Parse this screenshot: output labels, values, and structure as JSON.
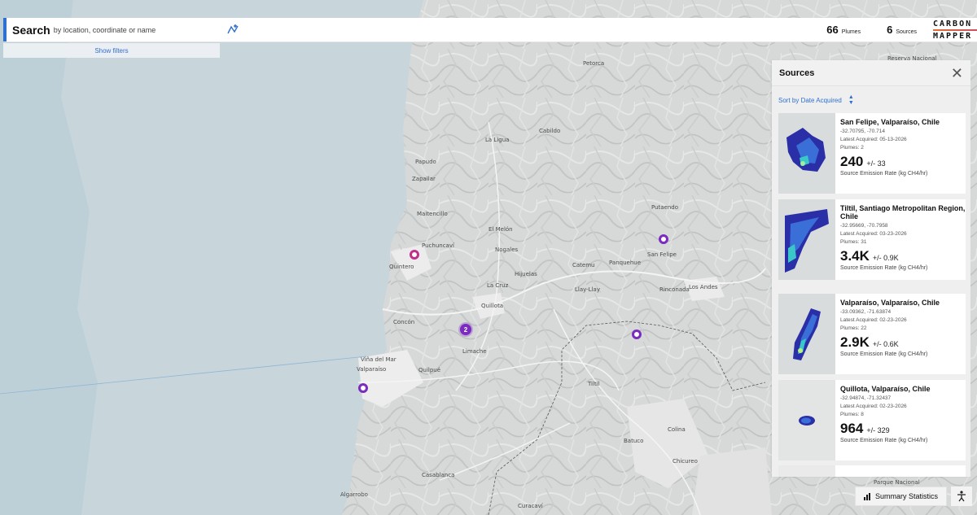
{
  "search": {
    "label": "Search",
    "placeholder": "by location, coordinate or name"
  },
  "filters": {
    "show_label": "Show filters"
  },
  "stats": {
    "plumes_count": "66",
    "plumes_label": "Plumes",
    "sources_count": "6",
    "sources_label": "Sources"
  },
  "logo": {
    "line1": "CARBON",
    "line2": "MAPPER"
  },
  "map": {
    "places": [
      "Petorca",
      "Cabildo",
      "La Ligua",
      "Papudo",
      "Zapallar",
      "Maitencillo",
      "El Melón",
      "Puchuncaví",
      "Nogales",
      "Quintero",
      "Hijuelas",
      "Catemu",
      "Panquehue",
      "San Felipe",
      "Putaendo",
      "La Cruz",
      "Llay-Llay",
      "Rinconada",
      "Los Andes",
      "Quillota",
      "Concón",
      "Limache",
      "Viña del Mar",
      "Valparaíso",
      "Quilpué",
      "Tiltil",
      "Colina",
      "Batuco",
      "Chicureo",
      "Casablanca",
      "Curacaví",
      "Algarrobo",
      "Parque Nacional",
      "Reserva Nacional"
    ],
    "cluster_count": "2"
  },
  "panel": {
    "title": "Sources",
    "sort_prefix": "Sort by",
    "sort_field": "Date Acquired",
    "cards": [
      {
        "title": "San Felipe, Valparaíso, Chile",
        "coords": "-32.70795, -70.714",
        "acquired": "Latest Acquired: 05-13-2026",
        "plumes": "Plumes: 2",
        "rate": "240",
        "error": "+/- 33",
        "rate_label": "Source Emission Rate (kg CH4/hr)"
      },
      {
        "title": "Tiltil, Santiago Metropolitan Region, Chile",
        "coords": "-32.95669, -70.7958",
        "acquired": "Latest Acquired: 03-23-2026",
        "plumes": "Plumes: 31",
        "rate": "3.4K",
        "error": "+/- 0.9K",
        "rate_label": "Source Emission Rate (kg CH4/hr)"
      },
      {
        "title": "Valparaíso, Valparaíso, Chile",
        "coords": "-33.09362, -71.63874",
        "acquired": "Latest Acquired: 02-23-2026",
        "plumes": "Plumes: 22",
        "rate": "2.9K",
        "error": "+/- 0.6K",
        "rate_label": "Source Emission Rate (kg CH4/hr)"
      },
      {
        "title": "Quillota, Valparaíso, Chile",
        "coords": "-32.94874, -71.32437",
        "acquired": "Latest Acquired: 02-23-2026",
        "plumes": "Plumes: 8",
        "rate": "964",
        "error": "+/- 329",
        "rate_label": "Source Emission Rate (kg CH4/hr)"
      }
    ]
  },
  "summary": {
    "label": "Summary Statistics"
  },
  "colors": {
    "accent": "#2f6fd0",
    "marker": "#7b2cbf",
    "marker_pink": "#c0308a",
    "ocean": "#c7d6dc"
  }
}
